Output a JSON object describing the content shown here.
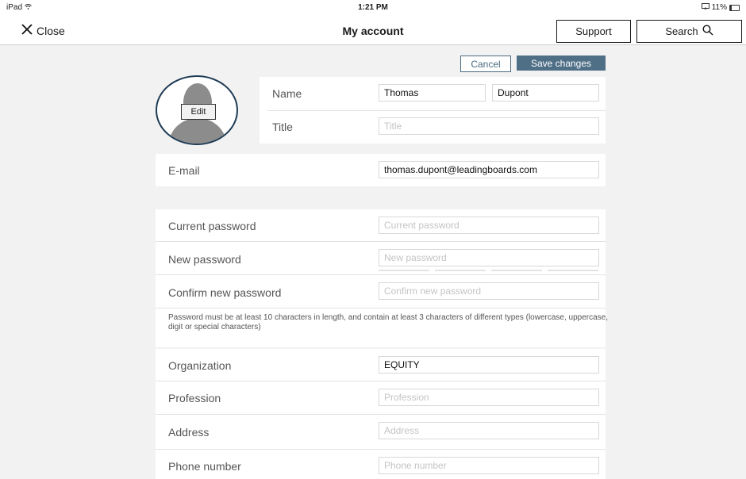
{
  "status": {
    "device": "iPad",
    "time": "1:21 PM",
    "battery": "11%"
  },
  "nav": {
    "close_label": "Close",
    "title": "My account",
    "support_label": "Support",
    "search_label": "Search"
  },
  "actions": {
    "cancel_label": "Cancel",
    "save_label": "Save changes"
  },
  "avatar": {
    "edit_label": "Edit"
  },
  "profile": {
    "name_label": "Name",
    "first_name": "Thomas",
    "last_name": "Dupont",
    "title_label": "Title",
    "title_placeholder": "Title",
    "email_label": "E-mail",
    "email": "thomas.dupont@leadingboards.com"
  },
  "password": {
    "current_label": "Current password",
    "current_placeholder": "Current password",
    "new_label": "New password",
    "new_placeholder": "New password",
    "confirm_label": "Confirm new password",
    "confirm_placeholder": "Confirm new password",
    "hint": "Password must be at least 10 characters in length, and contain at least 3 characters of different types (lowercase, uppercase, digit or special characters)"
  },
  "details": {
    "organization_label": "Organization",
    "organization": "EQUITY",
    "profession_label": "Profession",
    "profession_placeholder": "Profession",
    "address_label": "Address",
    "address_placeholder": "Address",
    "phone_label": "Phone number",
    "phone_placeholder": "Phone number"
  }
}
